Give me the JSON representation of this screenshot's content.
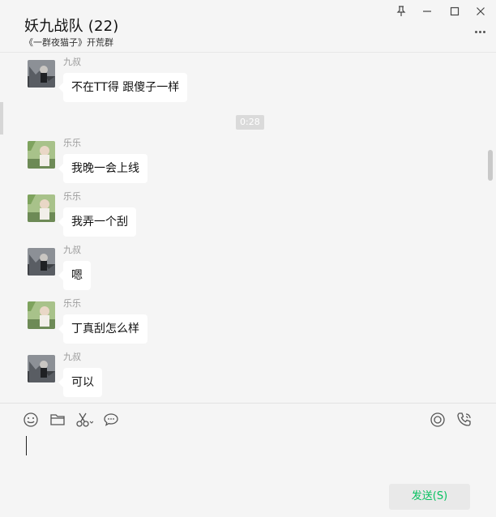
{
  "window": {
    "title": "妖九战队 (22)",
    "subtitle": "《一群夜猫子》开荒群",
    "controls": [
      "pin-icon",
      "minimize-icon",
      "maximize-icon",
      "close-icon"
    ],
    "more_icon": "more-icon"
  },
  "chat": {
    "time_chip": "0:28",
    "messages": [
      {
        "sender": "九叔",
        "text": "不在TT得 跟傻子一样",
        "avatar": "dark-avatar"
      },
      {
        "sender": "乐乐",
        "text": "我晚一会上线",
        "avatar": "green-avatar"
      },
      {
        "sender": "乐乐",
        "text": "我弄一个刮",
        "avatar": "green-avatar"
      },
      {
        "sender": "九叔",
        "text": "嗯",
        "avatar": "dark-avatar"
      },
      {
        "sender": "乐乐",
        "text": "丁真刮怎么样",
        "avatar": "green-avatar"
      },
      {
        "sender": "九叔",
        "text": "可以",
        "avatar": "dark-avatar"
      }
    ]
  },
  "toolbar": {
    "left_icons": [
      "emoji-icon",
      "folder-icon",
      "scissors-icon",
      "chat-bubble-icon"
    ],
    "right_icons": [
      "live-icon",
      "call-icon"
    ]
  },
  "input": {
    "value": ""
  },
  "send_button": {
    "label": "发送(S)",
    "color": "#07c160"
  },
  "colors": {
    "background": "#f5f5f5",
    "bubble": "#ffffff",
    "accent": "#07c160"
  }
}
